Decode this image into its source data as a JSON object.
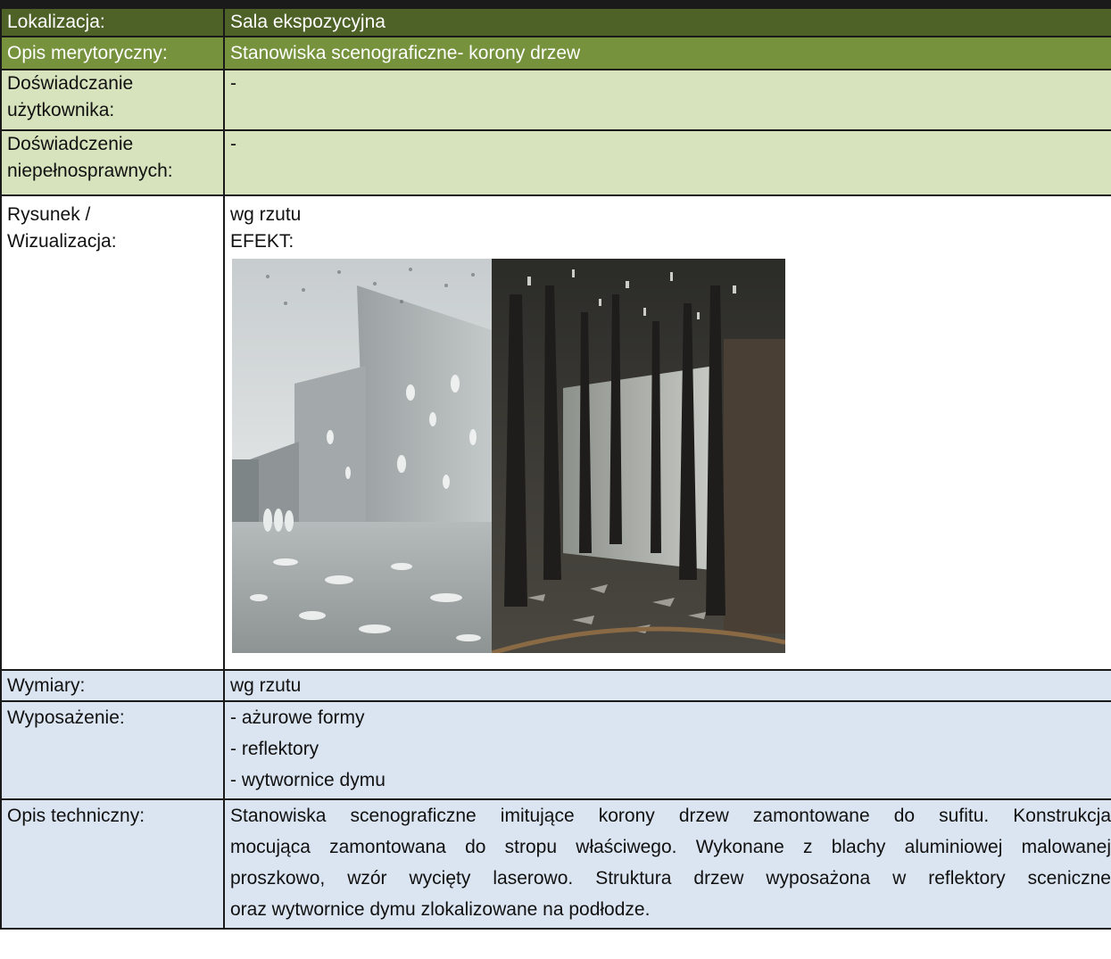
{
  "rows": {
    "location": {
      "label": "Lokalizacja:",
      "value": "Sala ekspozycyjna"
    },
    "content_description": {
      "label": "Opis merytoryczny:",
      "value": "Stanowiska scenograficzne- korony drzew"
    },
    "user_experience": {
      "label_line1": "Doświadczanie",
      "label_line2": "użytkownika:",
      "value": "-"
    },
    "disabled_experience": {
      "label_line1": "Doświadczenie",
      "label_line2": "niepełnosprawnych:",
      "value": "-"
    },
    "drawing": {
      "label_line1": "Rysunek /",
      "label_line2": "Wizualizacja:",
      "value_line1": "wg rzutu",
      "value_line2": "EFEKT:",
      "images": [
        "gallery-render-dappled-light",
        "dark-hall-render-tree-trunks"
      ]
    },
    "dimensions": {
      "label": "Wymiary:",
      "value": "wg rzutu"
    },
    "equipment": {
      "label": "Wyposażenie:",
      "items": [
        "- ażurowe formy",
        "- reflektory",
        "- wytwornice dymu"
      ]
    },
    "technical_description": {
      "label": "Opis techniczny:",
      "lines": [
        "Stanowiska scenograficzne imitujące korony drzew zamontowane do sufitu. Konstrukcja",
        "mocująca zamontowana do stropu właściwego. Wykonane z blachy aluminiowej malowanej",
        "proszkowo, wzór wycięty laserowo. Struktura drzew wyposażona w reflektory sceniczne",
        "oraz wytwornice dymu zlokalizowane na podłodze."
      ]
    }
  },
  "colors": {
    "header_dark_green": "#4e6228",
    "header_mid_green": "#76923c",
    "light_green": "#d6e3bc",
    "light_blue": "#dbe5f1",
    "border": "#1a1a1a"
  }
}
